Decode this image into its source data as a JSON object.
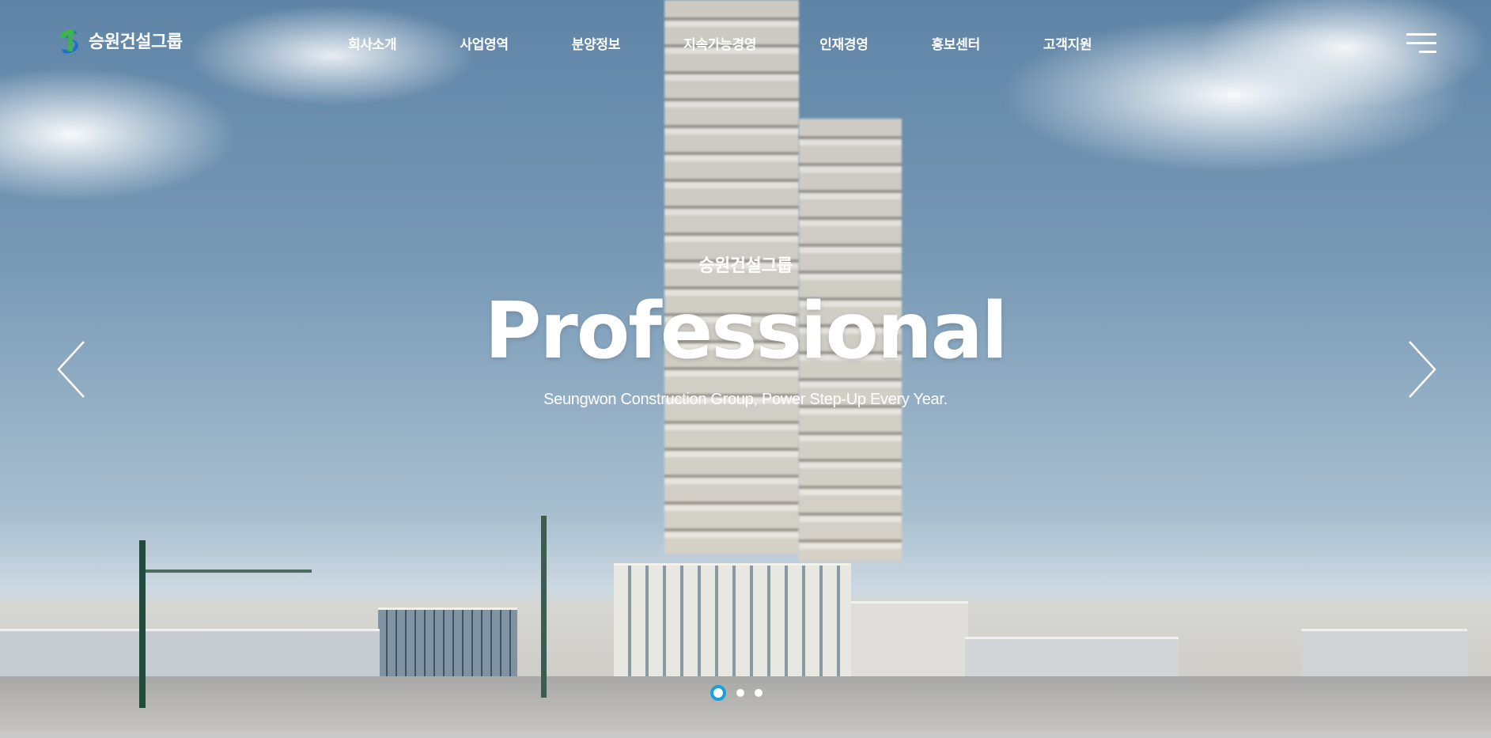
{
  "header": {
    "logo_text": "승원건설그룹",
    "nav": [
      "회사소개",
      "사업영역",
      "분양정보",
      "지속가능경영",
      "인재경영",
      "홍보센터",
      "고객지원"
    ]
  },
  "hero": {
    "eyebrow": "승원건설그룹",
    "headline": "Professional",
    "tagline": "Seungwon Construction Group, Power Step-Up Every Year."
  },
  "slider": {
    "slide_count": 3,
    "active_slide": 1
  },
  "icons": {
    "prev": "chevron-left-icon",
    "next": "chevron-right-icon",
    "menu": "hamburger-icon"
  },
  "colors": {
    "accent": "#1aa0e0",
    "logo_blue": "#1b73c8",
    "logo_green": "#3cb54a"
  }
}
